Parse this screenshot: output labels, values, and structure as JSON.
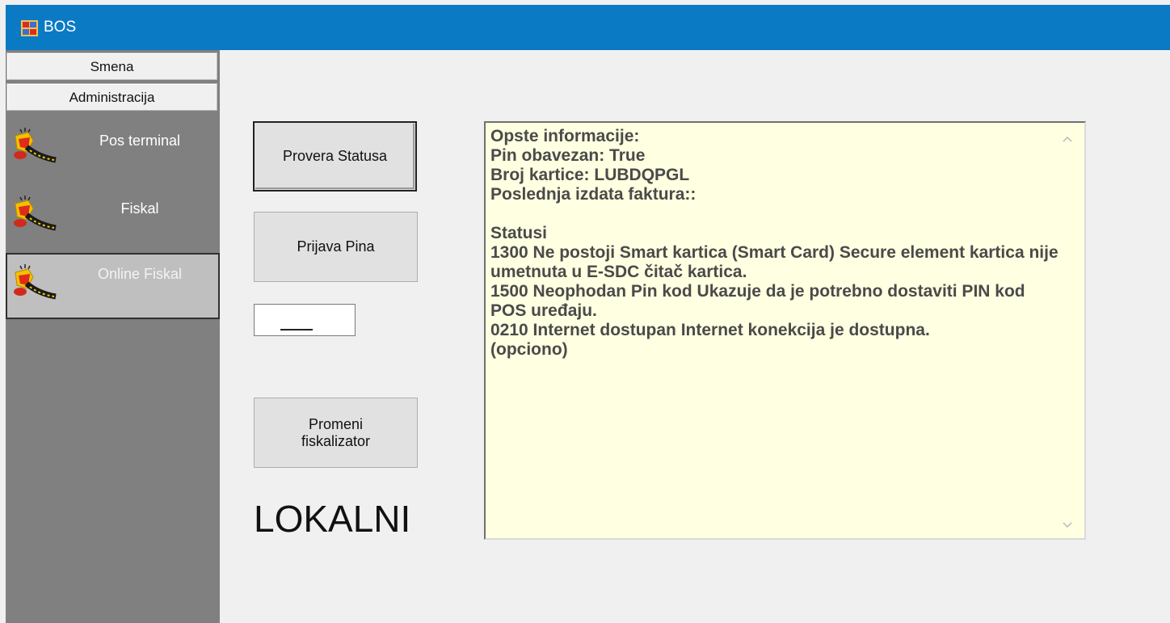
{
  "window": {
    "title": "BOS",
    "title_bar_color": "#0b7ac5",
    "icon": "app-window-icon"
  },
  "sidebar": {
    "tabs": [
      {
        "label": "Smena"
      },
      {
        "label": "Administracija"
      }
    ],
    "items": [
      {
        "label": "Pos terminal",
        "icon": "firecracker-icon",
        "selected": false
      },
      {
        "label": "Fiskal",
        "icon": "firecracker-icon",
        "selected": false
      },
      {
        "label": "Online Fiskal",
        "icon": "firecracker-icon",
        "selected": true
      }
    ]
  },
  "actions": {
    "check_status_label": "Provera Statusa",
    "pin_login_label": "Prijava Pina",
    "pin_value": "",
    "change_fiscalizer_label": "Promeni\nfiskalizator",
    "mode_label": "LOKALNI"
  },
  "info": {
    "text": "Opste informacije:\nPin obavezan: True\nBroj kartice: LUBDQPGL\nPoslednja izdata faktura::\n\nStatusi\n1300 Ne postoji Smart kartica (Smart Card) Secure element kartica nije umetnuta u E-SDC čitač kartica.\n1500 Neophodan Pin kod Ukazuje da je potrebno dostaviti PIN kod POS uređaju.\n0210 Internet dostupan Internet konekcija je dostupna.\n(opciono)",
    "background_color": "#ffffe1"
  }
}
